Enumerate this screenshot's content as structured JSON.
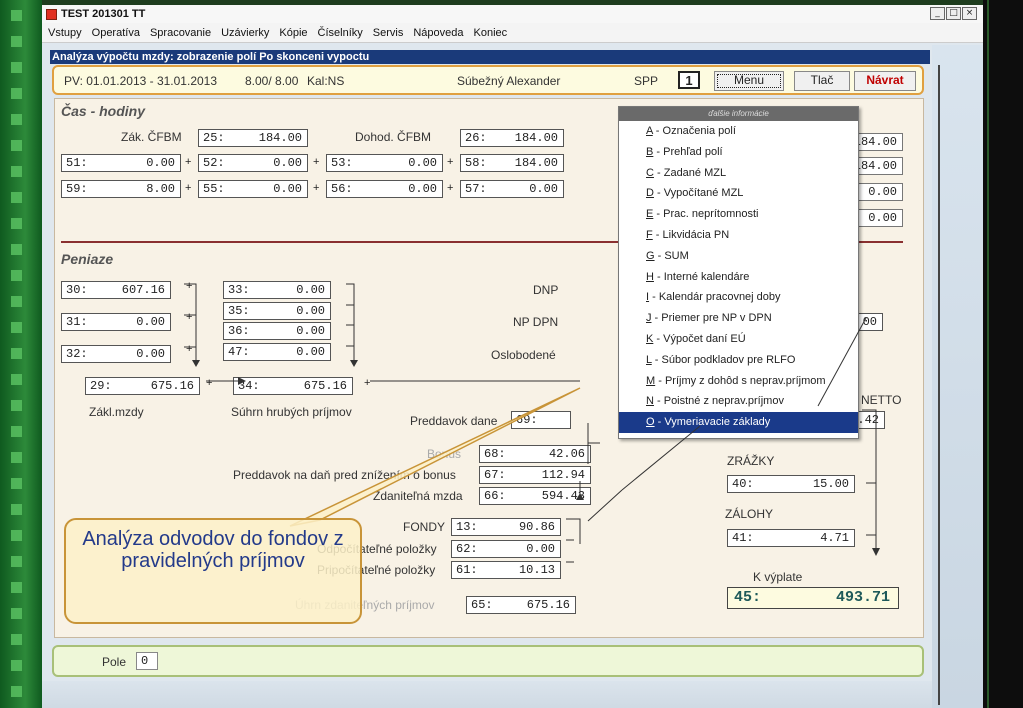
{
  "window": {
    "title": "TEST 201301 TT",
    "controls": [
      "_",
      "□",
      "×"
    ]
  },
  "menubar": [
    "Vstupy",
    "Operatíva",
    "Spracovanie",
    "Uzávierky",
    "Kópie",
    "Číselníky",
    "Servis",
    "Nápoveda",
    "Koniec"
  ],
  "subtitle": "Analýza výpočtu mzdy: zobrazenie polí Po skonceni vypoctu",
  "header": {
    "period": "PV: 01.01.2013 - 31.01.2013",
    "hours": "8.00/ 8.00",
    "cal": "Kal:NS",
    "name": "Súbežný Alexander",
    "spp_label": "SPP",
    "spp_value": "1",
    "menu_btn": "Menu",
    "print_btn": "Tlač",
    "back_btn": "Návrat"
  },
  "time_section": {
    "title": "Čas - hodiny",
    "zak_label": "Zák. ČFBM",
    "dohod_label": "Dohod. ČFBM",
    "f25": {
      "code": "25:",
      "value": "184.00"
    },
    "f26": {
      "code": "26:",
      "value": "184.00"
    },
    "f51": {
      "code": "51:",
      "value": "0.00"
    },
    "f52": {
      "code": "52:",
      "value": "0.00"
    },
    "f53": {
      "code": "53:",
      "value": "0.00"
    },
    "f58": {
      "code": "58:",
      "value": "184.00"
    },
    "f59": {
      "code": "59:",
      "value": "8.00"
    },
    "f55": {
      "code": "55:",
      "value": "0.00"
    },
    "f56": {
      "code": "56:",
      "value": "0.00"
    },
    "f57": {
      "code": "57:",
      "value": "0.00"
    },
    "right_vals": [
      "184.00",
      "184.00",
      "0.00",
      "0.00"
    ]
  },
  "money_section": {
    "title": "Peniaze",
    "f30": {
      "code": "30:",
      "value": "607.16"
    },
    "f31": {
      "code": "31:",
      "value": "0.00"
    },
    "f32": {
      "code": "32:",
      "value": "0.00"
    },
    "f33": {
      "code": "33:",
      "value": "0.00"
    },
    "f35": {
      "code": "35:",
      "value": "0.00"
    },
    "f36": {
      "code": "36:",
      "value": "0.00"
    },
    "f47": {
      "code": "47:",
      "value": "0.00"
    },
    "f29": {
      "code": "29:",
      "value": "675.16"
    },
    "f34": {
      "code": "34:",
      "value": "675.16"
    },
    "zakl_mzdy": "Zákl.mzdy",
    "suhrn": "Súhrn hrubých príjmov",
    "dnp": "DNP",
    "np_dpn": "NP DPN",
    "oslobodene": "Oslobodené",
    "preddavok_dane": "Preddavok dane",
    "preddavok_code": "69:",
    "bonus_label": "Bonus",
    "f68": {
      "code": "68:",
      "value": "42.06"
    },
    "preddavok_bonus_label": "Preddavok na daň pred znížením o bonus",
    "f67": {
      "code": "67:",
      "value": "112.94"
    },
    "zdanitelna_label": "Zdaniteľná mzda",
    "f66": {
      "code": "66:",
      "value": "594.43"
    },
    "fondy_label": "FONDY",
    "f13": {
      "code": "13:",
      "value": "90.86"
    },
    "odpoc_label": "Odpočítateľné položky",
    "f62": {
      "code": "62:",
      "value": "0.00"
    },
    "pripoc_label": "Pripočítateľné položky",
    "f61": {
      "code": "61:",
      "value": "10.13"
    },
    "uhrn_label": "Úhrn zdaniteľných príjmov",
    "f65": {
      "code": "65:",
      "value": "675.16"
    },
    "right_top_val": "00",
    "netto_label": "NETTO",
    "netto_val": "8.42",
    "zrazky_label": "ZRÁŽKY",
    "f40": {
      "code": "40:",
      "value": "15.00"
    },
    "zalohy_label": "ZÁLOHY",
    "f41": {
      "code": "41:",
      "value": "4.71"
    },
    "kvyplate_label": "K výplate",
    "f45": {
      "code": "45:",
      "value": "493.71"
    }
  },
  "popup": {
    "header": "ďalšie informácie",
    "items": [
      {
        "key": "A",
        "text": " - Označenia polí"
      },
      {
        "key": "B",
        "text": " - Prehľad polí"
      },
      {
        "key": "C",
        "text": " - Zadané MZL"
      },
      {
        "key": "D",
        "text": " - Vypočítané MZL"
      },
      {
        "key": "E",
        "text": " - Prac. neprítomnosti"
      },
      {
        "key": "F",
        "text": " - Likvidácia PN"
      },
      {
        "key": "G",
        "text": " - SUM"
      },
      {
        "key": "H",
        "text": " - Interné kalendáre"
      },
      {
        "key": "I",
        "text": " - Kalendár pracovnej doby"
      },
      {
        "key": "J",
        "text": " - Priemer pre NP v DPN"
      },
      {
        "key": "K",
        "text": " - Výpočet daní EÚ"
      },
      {
        "key": "L",
        "text": " - Súbor podkladov pre RLFO"
      },
      {
        "key": "M",
        "text": " - Príjmy z dohôd s neprav.príjmom"
      },
      {
        "key": "N",
        "text": " - Poistné z neprav.príjmov"
      },
      {
        "key": "O",
        "text": " - Vymeriavacie základy"
      }
    ]
  },
  "footer": {
    "label": "Pole",
    "value": "0"
  },
  "callout": {
    "text": "Analýza odvodov do fondov z pravidelných príjmov"
  }
}
